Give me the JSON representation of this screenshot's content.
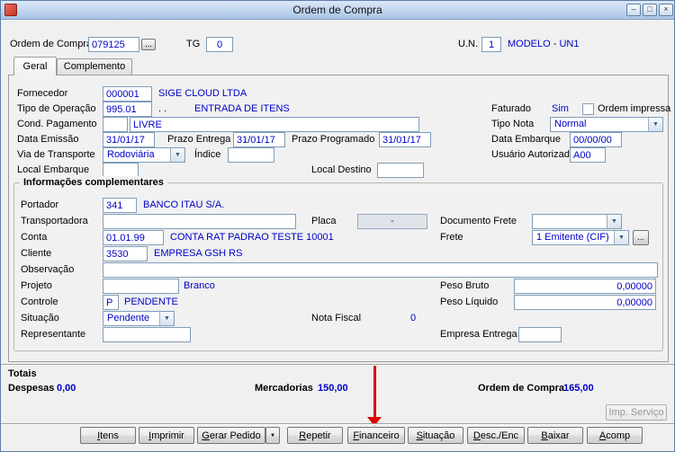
{
  "window": {
    "title": "Ordem de Compra"
  },
  "icons": {
    "dropdown": "▼",
    "minimize": "–",
    "maximize": "□",
    "close": "×"
  },
  "colors": {
    "value_text": "#0000c8",
    "field_border": "#7f9db9",
    "titlebar_top": "#dbe8f9",
    "titlebar_bottom": "#a9c4e4",
    "arrow": "#e00000"
  },
  "header": {
    "order_label": "Ordem de Compra",
    "order_value": "079125",
    "lookup_label": "...",
    "tg_label": "TG",
    "tg_value": "0",
    "un_label": "U.N.",
    "un_value": "1",
    "un_name": "MODELO - UN1"
  },
  "tabs": {
    "geral": "Geral",
    "complemento": "Complemento"
  },
  "geral": {
    "fornecedor_label": "Fornecedor",
    "fornecedor_code": "000001",
    "fornecedor_name": "SIGE CLOUD LTDA",
    "tipo_operacao_label": "Tipo de Operação",
    "tipo_operacao_code": "995.01",
    "tipo_operacao_dots": ". .",
    "tipo_operacao_name": "ENTRADA DE ITENS",
    "faturado_label": "Faturado",
    "faturado_value": "Sim",
    "ordem_impressa_label": "Ordem impressa",
    "cond_pagamento_label": "Cond. Pagamento",
    "cond_pagamento_code": "",
    "cond_pagamento_name": "LIVRE",
    "tipo_nota_label": "Tipo Nota",
    "tipo_nota_value": "Normal",
    "data_emissao_label": "Data Emissão",
    "data_emissao_value": "31/01/17",
    "prazo_entrega_label": "Prazo Entrega",
    "prazo_entrega_value": "31/01/17",
    "prazo_programado_label": "Prazo Programado",
    "prazo_programado_value": "31/01/17",
    "data_embarque_label": "Data Embarque",
    "data_embarque_value": "00/00/00",
    "via_transporte_label": "Via de Transporte",
    "via_transporte_value": "Rodoviária",
    "indice_label": "Índice",
    "indice_value": "",
    "usuario_autorizado_label": "Usuário Autorizado",
    "usuario_autorizado_value": "A00",
    "local_embarque_label": "Local Embarque",
    "local_embarque_value": "",
    "local_destino_label": "Local Destino",
    "local_destino_value": ""
  },
  "complementares": {
    "group_title": "Informações complementares",
    "portador_label": "Portador",
    "portador_code": "341",
    "portador_name": "BANCO ITAU S/A.",
    "transportadora_label": "Transportadora",
    "transportadora_value": "",
    "placa_label": "Placa",
    "placa_value": "-",
    "documento_frete_label": "Documento Frete",
    "documento_frete_value": "",
    "conta_label": "Conta",
    "conta_code": "01.01.99",
    "conta_name": "CONTA RAT PADRAO TESTE 10001",
    "frete_label": "Frete",
    "frete_value": "1 Emitente (CIF)",
    "frete_lookup": "...",
    "cliente_label": "Cliente",
    "cliente_code": "3530",
    "cliente_name": "EMPRESA GSH RS",
    "observacao_label": "Observação",
    "observacao_value": "",
    "projeto_label": "Projeto",
    "projeto_value": "",
    "projeto_name": "Branco",
    "peso_bruto_label": "Peso Bruto",
    "peso_bruto_value": "0,00000",
    "controle_label": "Controle",
    "controle_code": "P",
    "controle_name": "PENDENTE",
    "peso_liquido_label": "Peso Líquido",
    "peso_liquido_value": "0,00000",
    "situacao_label": "Situação",
    "situacao_value": "Pendente",
    "nota_fiscal_label": "Nota Fiscal",
    "nota_fiscal_value": "0",
    "representante_label": "Representante",
    "representante_value": "",
    "empresa_entrega_label": "Empresa Entrega",
    "empresa_entrega_value": ""
  },
  "totais": {
    "title": "Totais",
    "despesas_label": "Despesas",
    "despesas_value": "0,00",
    "mercadorias_label": "Mercadorias",
    "mercadorias_value": "150,00",
    "ordem_label": "Ordem de Compra",
    "ordem_value": "165,00"
  },
  "footer": {
    "imp_servico_label": "Imp. Serviço",
    "buttons": [
      {
        "label": "Itens",
        "mnemonic": 0
      },
      {
        "label": "Imprimir",
        "mnemonic": 0
      },
      {
        "label": "Gerar Pedido",
        "mnemonic": 0
      },
      {
        "label": "Repetir",
        "mnemonic": 0
      },
      {
        "label": "Financeiro",
        "mnemonic": 0
      },
      {
        "label": "Situação",
        "mnemonic": 0
      },
      {
        "label": "Desc./Enc",
        "mnemonic": 0
      },
      {
        "label": "Baixar",
        "mnemonic": 0
      },
      {
        "label": "Acomp",
        "mnemonic": 0
      }
    ]
  }
}
